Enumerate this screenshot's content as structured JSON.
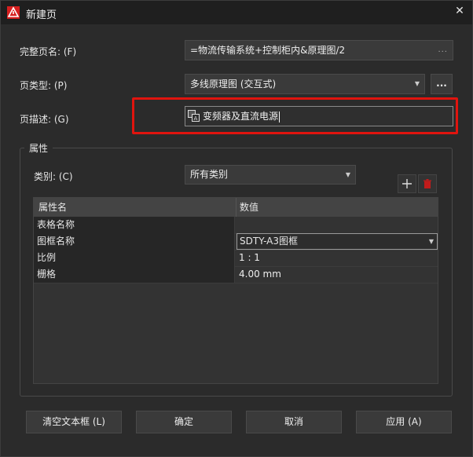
{
  "window": {
    "title": "新建页"
  },
  "fields": {
    "full_page_name": {
      "label": "完整页名: (F)",
      "value": "=物流传输系统+控制柜内&原理图/2",
      "more": "..."
    },
    "page_type": {
      "label": "页类型: (P)",
      "value": "多线原理图 (交互式)",
      "more": "..."
    },
    "page_desc": {
      "label": "页描述: (G)",
      "value": "变频器及直流电源"
    }
  },
  "properties": {
    "group_title": "属性",
    "category_label": "类别: (C)",
    "category_value": "所有类别",
    "columns": [
      "属性名",
      "数值"
    ],
    "rows": [
      {
        "name": "表格名称",
        "value": ""
      },
      {
        "name": "图框名称",
        "value": "SDTY-A3图框"
      },
      {
        "name": "比例",
        "value": "1 : 1"
      },
      {
        "name": "栅格",
        "value": "4.00 mm"
      }
    ]
  },
  "buttons": {
    "clear": "清空文本框 (L)",
    "ok": "确定",
    "cancel": "取消",
    "apply": "应用 (A)"
  },
  "colors": {
    "highlight": "#e0140e",
    "background": "#2b2b2b",
    "titlebar": "#1f1f1f"
  }
}
